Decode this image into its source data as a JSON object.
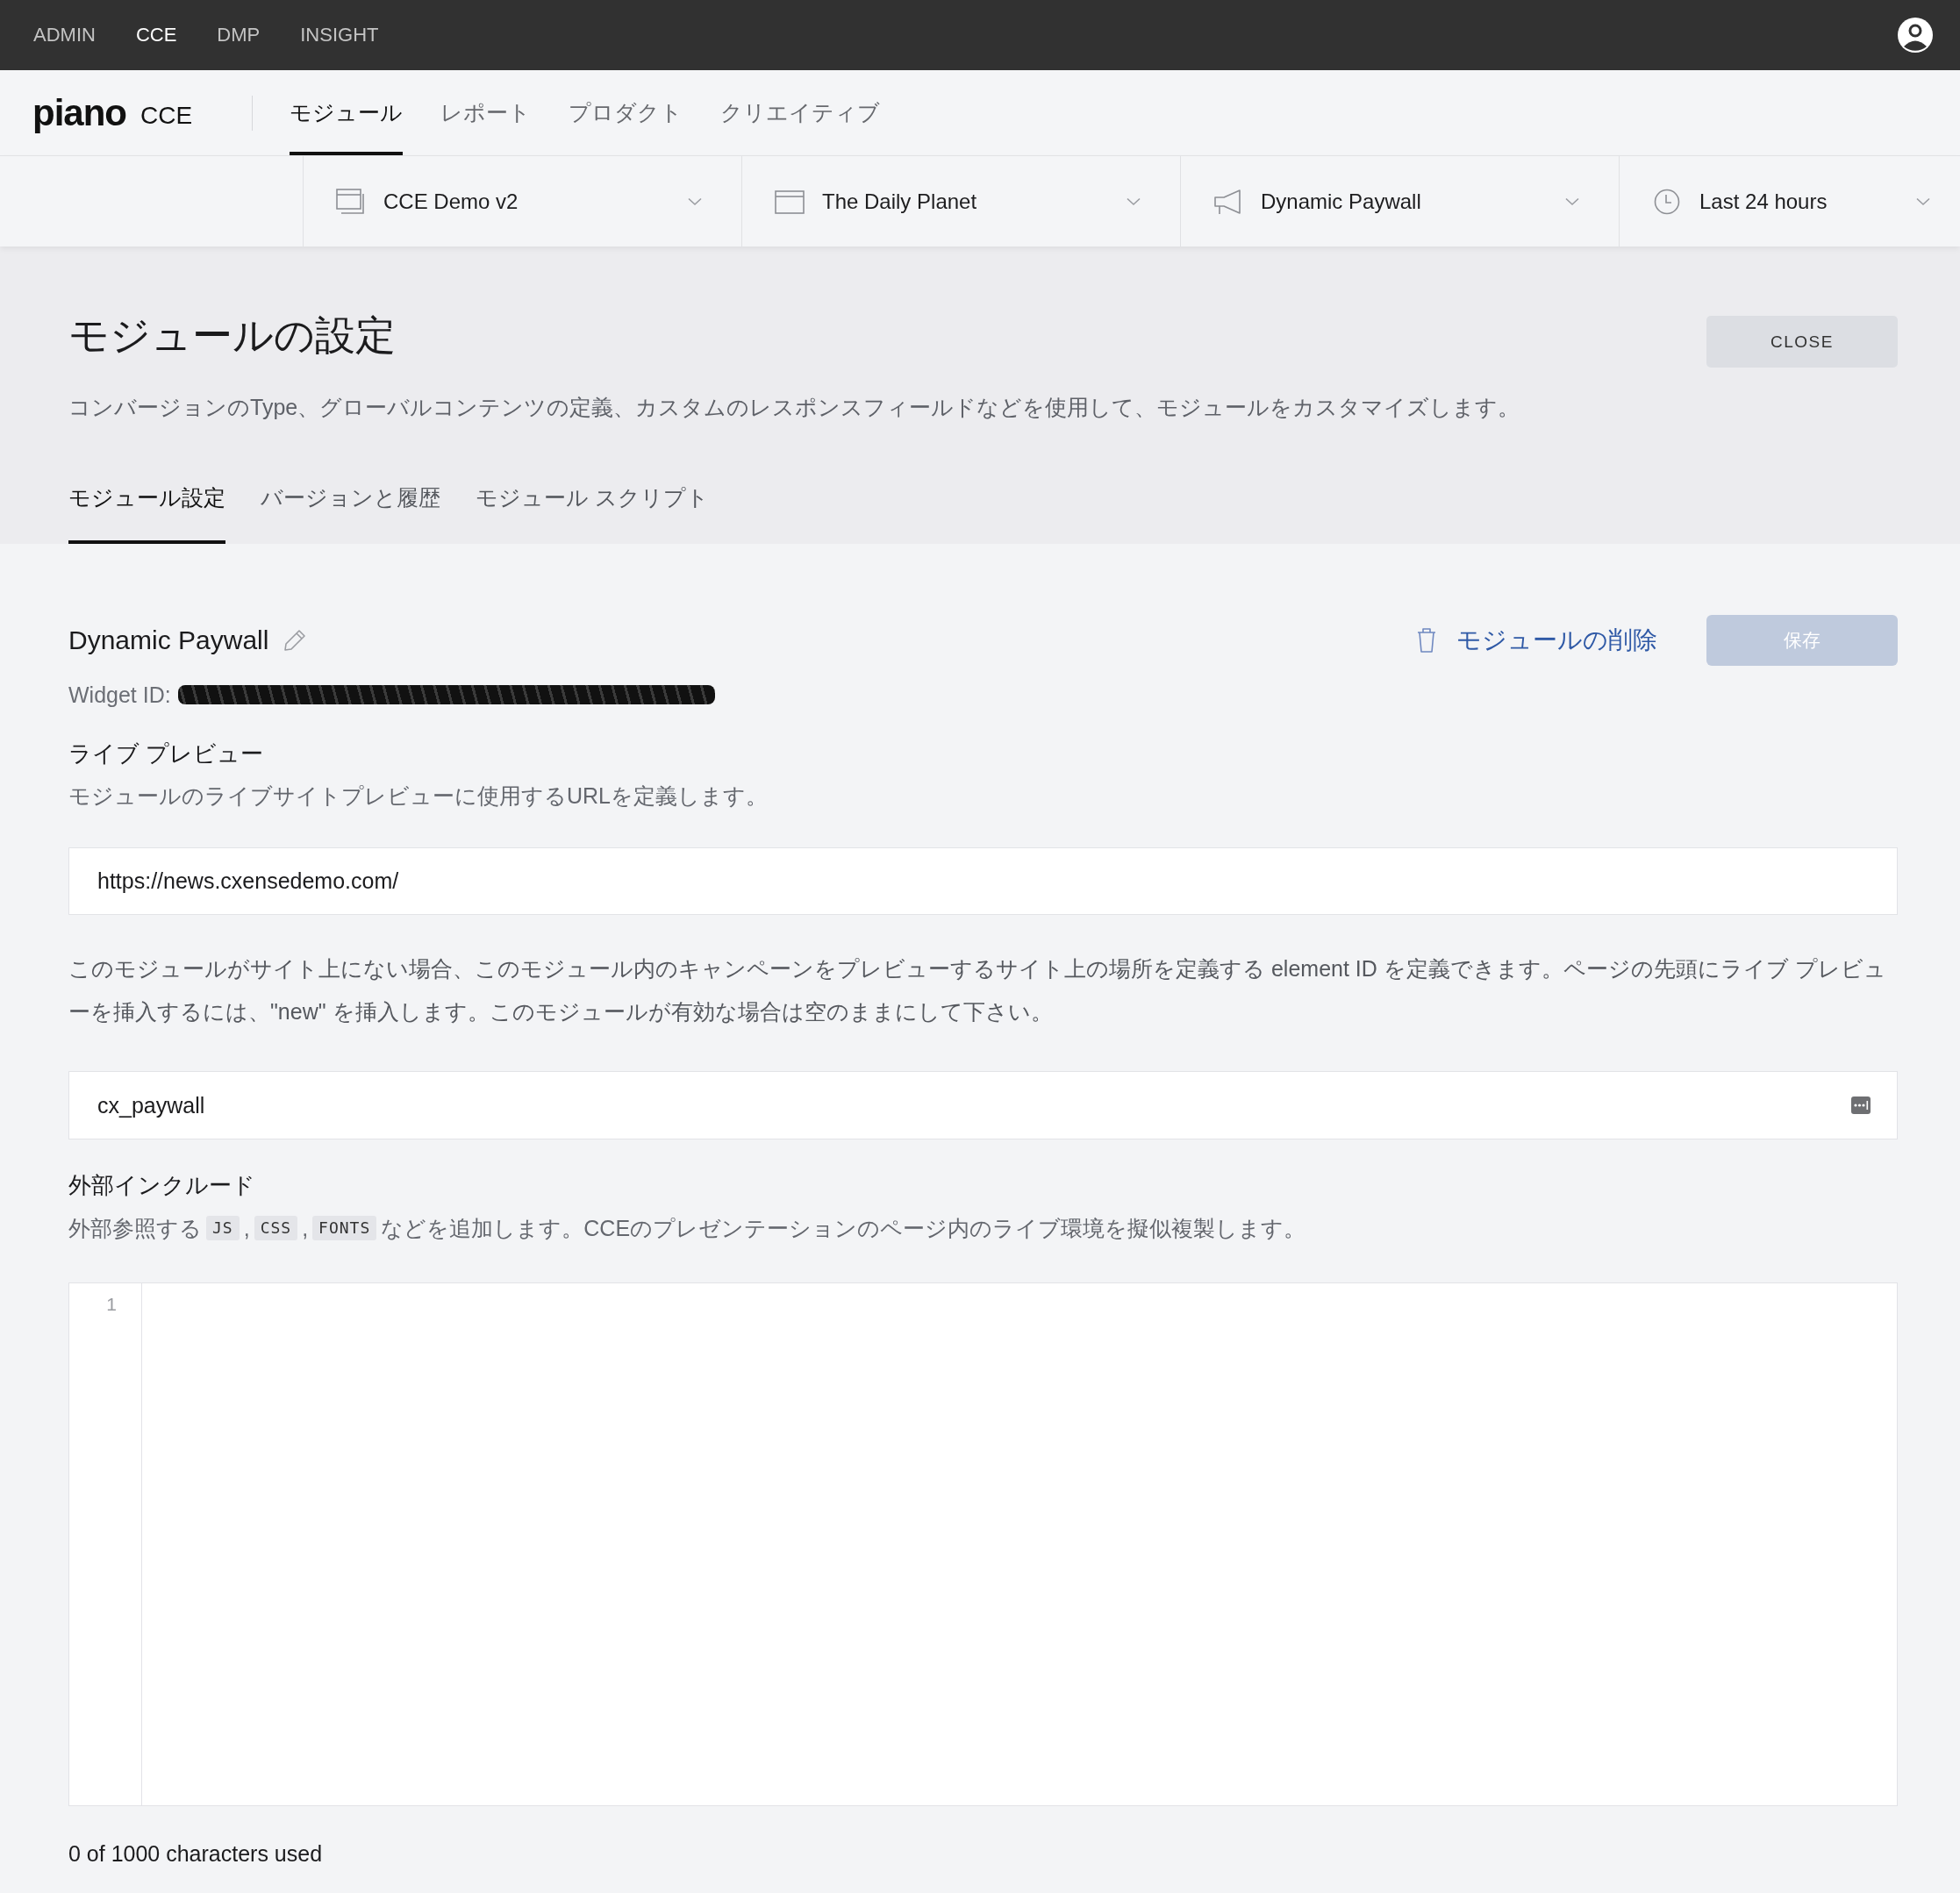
{
  "top_bar": {
    "items": [
      {
        "label": "ADMIN",
        "selected": false
      },
      {
        "label": "CCE",
        "selected": true
      },
      {
        "label": "DMP",
        "selected": false
      },
      {
        "label": "INSIGHT",
        "selected": false
      }
    ]
  },
  "header": {
    "logo": "piano",
    "product": "CCE",
    "nav": [
      {
        "label": "モジュール",
        "selected": true
      },
      {
        "label": "レポート",
        "selected": false
      },
      {
        "label": "プロダクト",
        "selected": false
      },
      {
        "label": "クリエイティブ",
        "selected": false
      }
    ]
  },
  "filters": [
    {
      "kind": "application",
      "label": "CCE Demo v2"
    },
    {
      "kind": "site",
      "label": "The Daily Planet"
    },
    {
      "kind": "campaign",
      "label": "Dynamic Paywall"
    },
    {
      "kind": "period",
      "label": "Last 24 hours"
    }
  ],
  "page_header": {
    "title": "モジュールの設定",
    "description": "コンバージョンのType、グローバルコンテンツの定義、カスタムのレスポンスフィールドなどを使用して、モジュールをカスタマイズします。",
    "close_button": "CLOSE",
    "tabs": [
      {
        "label": "モジュール設定",
        "selected": true
      },
      {
        "label": "バージョンと履歴",
        "selected": false
      },
      {
        "label": "モジュール スクリプト",
        "selected": false
      }
    ]
  },
  "module": {
    "name": "Dynamic Paywall",
    "delete_link": "モジュールの削除",
    "save_button": {
      "label": "保存",
      "disabled": true
    },
    "widget_id": {
      "label": "Widget ID:",
      "redacted": true
    }
  },
  "live_preview": {
    "heading": "ライブ プレビュー",
    "description": "モジュールのライブサイトプレビューに使用するURLを定義します。",
    "url_field": {
      "value": "https://news.cxensedemo.com/"
    },
    "element_note": "このモジュールがサイト上にない場合、このモジュール内のキャンペーンをプレビューするサイト上の場所を定義する element ID を定義できます。ページの先頭にライブ プレビューを挿入するには、\"new\" を挿入します。このモジュールが有効な場合は空のままにして下さい。",
    "element_field": {
      "value": "cx_paywall"
    }
  },
  "external_include": {
    "heading": "外部インクルード",
    "description": [
      {
        "kind": "text",
        "text": "外部参照する"
      },
      {
        "kind": "code",
        "text": "JS"
      },
      {
        "kind": "text",
        "text": ","
      },
      {
        "kind": "code",
        "text": "CSS"
      },
      {
        "kind": "text",
        "text": ","
      },
      {
        "kind": "code",
        "text": "FONTS"
      },
      {
        "kind": "text",
        "text": "などを追加します。CCEのプレゼンテーションのページ内のライブ環境を擬似複製します。"
      }
    ],
    "editor": {
      "line_numbers": [
        "1"
      ]
    },
    "counter": "0 of 1000 characters used"
  }
}
